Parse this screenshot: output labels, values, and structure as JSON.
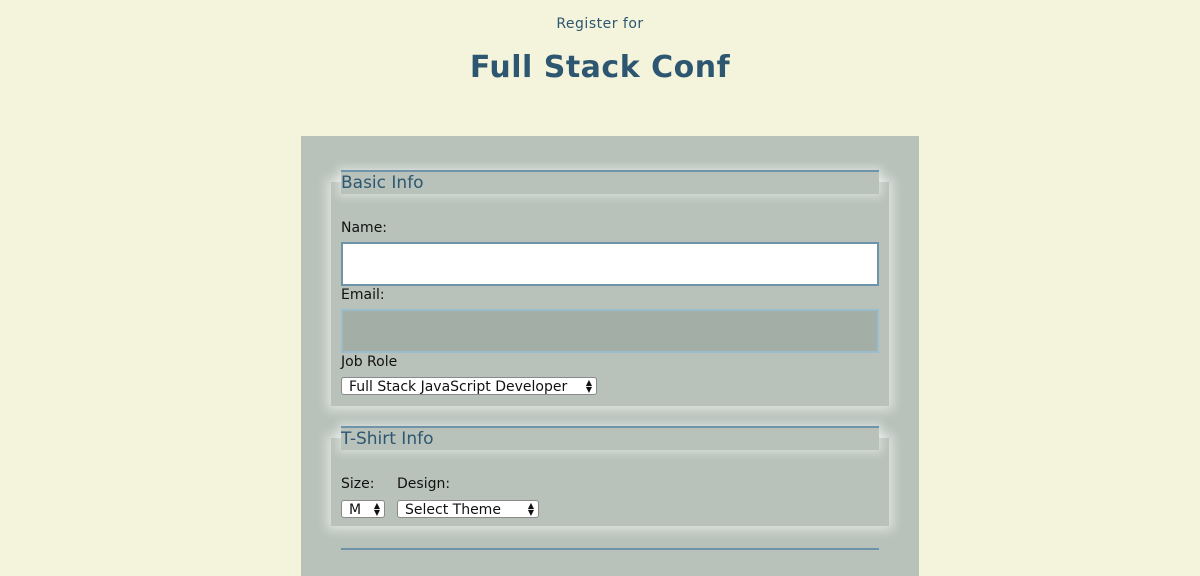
{
  "header": {
    "register_text": "Register for",
    "conference_title": "Full Stack Conf"
  },
  "basic_info": {
    "legend": "Basic Info",
    "name_label": "Name:",
    "name_value": "",
    "email_label": "Email:",
    "email_value": "",
    "job_role_label": "Job Role",
    "job_role_selected": "Full Stack JavaScript Developer"
  },
  "tshirt_info": {
    "legend": "T-Shirt Info",
    "size_label": "Size:",
    "size_selected": "M",
    "design_label": "Design:",
    "design_selected": "Select Theme"
  },
  "icons": {
    "select_arrows": "updown-chevron-icon"
  },
  "colors": {
    "page_background": "#f4f4dc",
    "panel_background": "#b8c2bb",
    "accent": "#2d5670",
    "input_border": "#6f93a8"
  }
}
